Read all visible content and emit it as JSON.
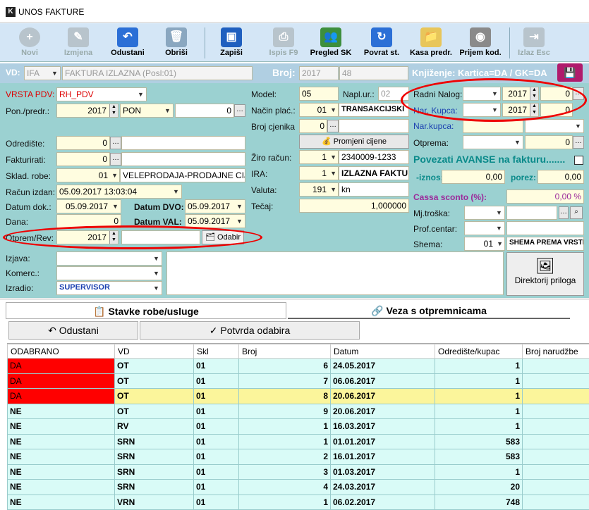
{
  "window": {
    "title": "UNOS FAKTURE"
  },
  "toolbar": [
    {
      "label": "Novi",
      "icon": "plus-icon",
      "disabled": true
    },
    {
      "label": "Izmjena",
      "icon": "edit-icon",
      "disabled": true
    },
    {
      "label": "Odustani",
      "icon": "undo-icon",
      "disabled": false
    },
    {
      "label": "Obriši",
      "icon": "trash-icon",
      "disabled": false
    },
    {
      "label": "Zapiši",
      "icon": "save-icon",
      "disabled": false
    },
    {
      "label": "Ispis F9",
      "icon": "printer-icon",
      "disabled": true
    },
    {
      "label": "Pregled SK",
      "icon": "users-icon",
      "disabled": false
    },
    {
      "label": "Povrat st.",
      "icon": "return-icon",
      "disabled": false
    },
    {
      "label": "Kasa predr.",
      "icon": "folder-icon",
      "disabled": false
    },
    {
      "label": "Prijem kod.",
      "icon": "webcam-icon",
      "disabled": false
    },
    {
      "label": "Izlaz Esc",
      "icon": "exit-icon",
      "disabled": true
    }
  ],
  "vdbar": {
    "vd_label": "VD:",
    "vd_value": "IFA",
    "vd_desc": "FAKTURA IZLAZNA (Posl:01)",
    "broj_label": "Broj:",
    "broj_year": "2017",
    "broj_num": "48",
    "knjizenje": "Knjiženje: Kartica=DA / GK=DA"
  },
  "left": {
    "vrsta_pdv_label": "VRSTA PDV:",
    "vrsta_pdv_value": "RH_PDV",
    "pon_label": "Pon./predr.:",
    "pon_year": "2017",
    "pon_type": "PON",
    "pon_num": "0",
    "odrediste_label": "Odredište:",
    "odrediste_value": "0",
    "fakturirati_label": "Fakturirati:",
    "fakturirati_value": "0",
    "sklad_label": "Sklad. robe:",
    "sklad_code": "01",
    "sklad_name": "VELEPRODAJA-PRODAJNE CIJ",
    "racun_label": "Račun izdan:",
    "racun_value": "05.09.2017 13:03:04",
    "datum_dok_label": "Datum dok.:",
    "datum_dok": "05.09.2017",
    "datum_dvo_label": "Datum DVO:",
    "datum_dvo": "05.09.2017",
    "dana_label": "Dana:",
    "dana_value": "0",
    "datum_val_label": "Datum VAL:",
    "datum_val": "05.09.2017",
    "otprem_label": "Otprem/Rev:",
    "otprem_year": "2017",
    "odabir_label": "Odabir",
    "izjava_label": "Izjava:",
    "komerc_label": "Komerc.:",
    "izradio_label": "Izradio:",
    "izradio_value": "SUPERVISOR"
  },
  "middle": {
    "model_label": "Model:",
    "model_value": "05",
    "naplur_label": "Napl.ur.:",
    "naplur_value": "02",
    "nacin_label": "Način plać.:",
    "nacin_code": "01",
    "nacin_name": "TRANSAKCIJSKI",
    "cjenik_label": "Broj cjenika",
    "cjenik_value": "0",
    "promjeni_label": "Promjeni cijene",
    "ziro_label": "Žiro račun:",
    "ziro_code": "1",
    "ziro_value": "2340009-1233",
    "ira_label": "IRA:",
    "ira_code": "1",
    "ira_value": "IZLAZNA FAKTURA",
    "valuta_label": "Valuta:",
    "valuta_code": "191",
    "valuta_value": "kn",
    "tecaj_label": "Tečaj:",
    "tecaj_value": "1,000000"
  },
  "right": {
    "radni_label": "Radni Nalog:",
    "radni_year": "2017",
    "radni_num": "0",
    "narkupca_label": "Nar. Kupca:",
    "narkupca_year": "2017",
    "narkupca_num": "0",
    "narkupca2_label": "Nar.kupca:",
    "otprema_label": "Otprema:",
    "otprema_num": "0",
    "avans_label": "Povezati AVANSE na fakturu.......",
    "iznos_label": "-iznos:",
    "iznos_value": "0,00",
    "porez_label": "porez:",
    "porez_value": "0,00",
    "cassa_label": "Cassa sconto (%):",
    "cassa_value": "0,00 %",
    "mjtroska_label": "Mj.troška:",
    "profcentar_label": "Prof.centar:",
    "shema_label": "Shema:",
    "shema_code": "01",
    "shema_value": "SHEMA PREMA VRSTI F",
    "direktorij_label": "Direktorij priloga"
  },
  "tabs": {
    "stavke": "Stavke robe/usluge",
    "veza": "Veza s otpremnicama"
  },
  "actions": {
    "odustani": "Odustani",
    "potvrda": "Potvrda odabira"
  },
  "table": {
    "headers": [
      "ODABRANO",
      "VD",
      "Skl",
      "Broj",
      "Datum",
      "Odredište/kupac",
      "Broj narudžbe"
    ],
    "rows": [
      [
        "DA",
        "OT",
        "01",
        "6",
        "24.05.2017",
        "1",
        ""
      ],
      [
        "DA",
        "OT",
        "01",
        "7",
        "06.06.2017",
        "1",
        ""
      ],
      [
        "DA",
        "OT",
        "01",
        "8",
        "20.06.2017",
        "1",
        ""
      ],
      [
        "NE",
        "OT",
        "01",
        "9",
        "20.06.2017",
        "1",
        ""
      ],
      [
        "NE",
        "RV",
        "01",
        "1",
        "16.03.2017",
        "1",
        ""
      ],
      [
        "NE",
        "SRN",
        "01",
        "1",
        "01.01.2017",
        "583",
        ""
      ],
      [
        "NE",
        "SRN",
        "01",
        "2",
        "16.01.2017",
        "583",
        ""
      ],
      [
        "NE",
        "SRN",
        "01",
        "3",
        "01.03.2017",
        "1",
        ""
      ],
      [
        "NE",
        "SRN",
        "01",
        "4",
        "24.03.2017",
        "20",
        ""
      ],
      [
        "NE",
        "VRN",
        "01",
        "1",
        "06.02.2017",
        "748",
        ""
      ]
    ]
  },
  "colors": {
    "form_bg": "#9bd1d1",
    "row_bg": "#d9fbf7",
    "selected_row": "#fbf59b",
    "da_red": "#ff0000",
    "highlight_oval": "#e00000"
  }
}
